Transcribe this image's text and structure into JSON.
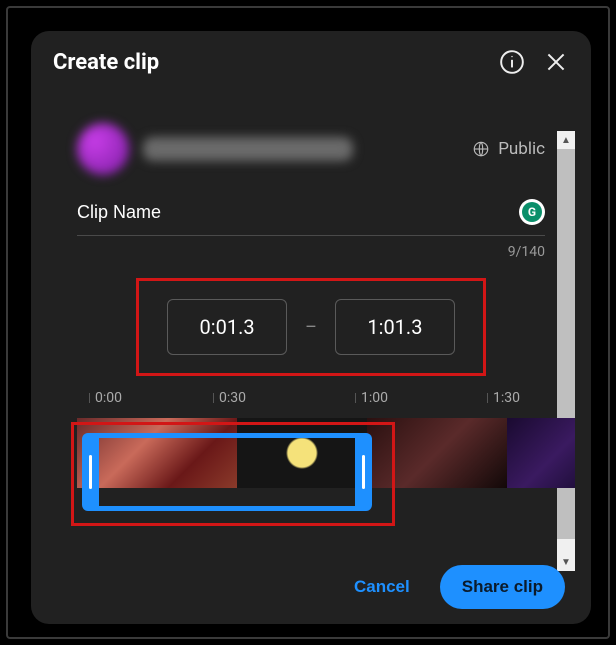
{
  "header": {
    "title": "Create clip"
  },
  "visibility": {
    "label": "Public"
  },
  "clip": {
    "name_value": "Clip Name",
    "counter": "9/140",
    "badge_letter": "G"
  },
  "time": {
    "start": "0:01.3",
    "dash": "–",
    "end": "1:01.3"
  },
  "ticks": {
    "t0": "0:00",
    "t30": "0:30",
    "t60": "1:00",
    "t90": "1:30"
  },
  "footer": {
    "cancel": "Cancel",
    "share": "Share clip"
  },
  "scrollbar": {
    "up": "▲",
    "down": "▼"
  }
}
